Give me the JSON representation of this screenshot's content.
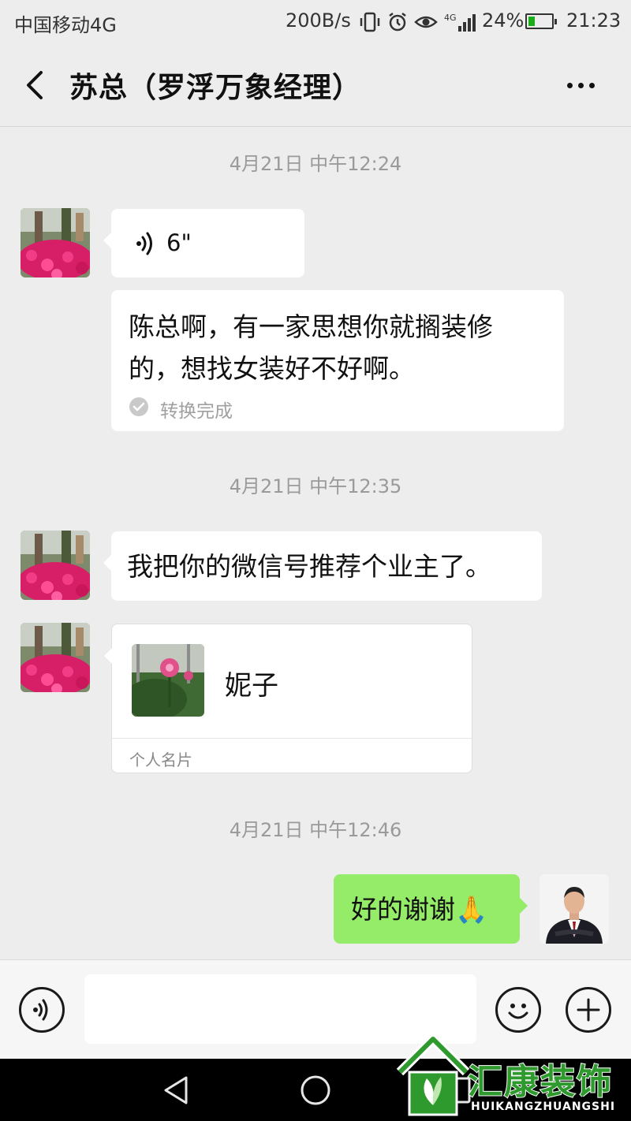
{
  "status_bar": {
    "carrier": "中国移动4G",
    "net_speed": "200B/s",
    "battery_percent": "24%",
    "battery_level": 0.24,
    "time": "21:23",
    "icons": [
      "vibrate-icon",
      "alarm-icon",
      "eye-icon",
      "signal-icon",
      "battery-icon"
    ]
  },
  "header": {
    "title": "苏总（罗浮万象经理）"
  },
  "messages": {
    "timestamp_1": "4月21日 中午12:24",
    "voice_duration": "6\"",
    "transcript_line1": "陈总啊，有一家思想你就搁装修",
    "transcript_line2": "的，想找女装好不好啊。",
    "transcript_status": "转换完成",
    "timestamp_2": "4月21日 中午12:35",
    "text_message": "我把你的微信号推荐个业主了。",
    "card_name": "妮子",
    "card_label": "个人名片",
    "timestamp_3": "4月21日 中午12:46",
    "reply_text": "好的谢谢🙏"
  },
  "watermark": {
    "brand": "汇康装饰",
    "brand_pinyin": "HUIKANGZHUANGSHI"
  },
  "colors": {
    "background": "#ededed",
    "sent_bubble": "#95ec69",
    "received_bubble": "#ffffff",
    "timestamp": "#9a9a9a",
    "brand_green": "#2e9a2e"
  }
}
